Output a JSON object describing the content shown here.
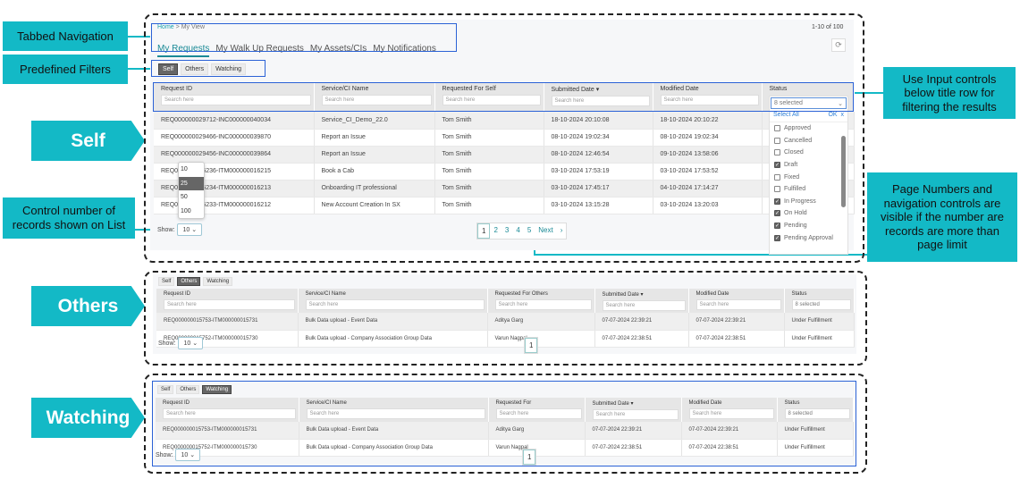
{
  "annotations": {
    "tabbed_navigation": "Tabbed Navigation",
    "predefined_filters": "Predefined Filters",
    "self": "Self",
    "others": "Others",
    "watching": "Watching",
    "control_records": "Control number of records shown on List",
    "input_controls": "Use Input controls below title row for filtering the results",
    "page_numbers": "Page Numbers and navigation controls are visible if the number are records are more than page limit"
  },
  "colors": {
    "accent": "#13b9c6",
    "annotation_border": "#2b62d6",
    "active_tab": "#1a8a96"
  },
  "header": {
    "breadcrumb_home": "Home",
    "breadcrumb_sep": ">",
    "breadcrumb_current": "My View",
    "record_count": "1-10 of 100",
    "refresh_icon": "refresh-icon",
    "tabs": [
      "My Requests",
      "My Walk Up Requests",
      "My Assets/CIs",
      "My Notifications"
    ]
  },
  "filters": [
    "Self",
    "Others",
    "Watching"
  ],
  "search_placeholder": "Search here",
  "status_filter": {
    "value": "8 selected",
    "select_all": "Select All",
    "ok": "OK",
    "close": "x",
    "options": [
      {
        "label": "Approved",
        "checked": false
      },
      {
        "label": "Cancelled",
        "checked": false
      },
      {
        "label": "Closed",
        "checked": false
      },
      {
        "label": "Draft",
        "checked": true
      },
      {
        "label": "Fixed",
        "checked": false
      },
      {
        "label": "Fulfilled",
        "checked": false
      },
      {
        "label": "In Progress",
        "checked": true
      },
      {
        "label": "On Hold",
        "checked": true
      },
      {
        "label": "Pending",
        "checked": true
      },
      {
        "label": "Pending Approval",
        "checked": true
      }
    ]
  },
  "show": {
    "label": "Show:",
    "value": "10",
    "options": [
      "10",
      "25",
      "50",
      "100"
    ],
    "highlighted": "25"
  },
  "pagination": {
    "pages": [
      "1",
      "2",
      "3",
      "4",
      "5"
    ],
    "current": "1",
    "next": "Next",
    "next_icon": "›"
  },
  "tables": {
    "self": {
      "columns": [
        "Request ID",
        "Service/CI Name",
        "Requested For Self",
        "Submitted Date ▾",
        "Modified Date",
        "Status"
      ],
      "rows": [
        [
          "REQ000000029712-INC000000040034",
          "Service_CI_Demo_22.0",
          "Tom Smith",
          "18-10-2024 20:10:08",
          "18-10-2024 20:10:22",
          ""
        ],
        [
          "REQ000000029466-INC000000039870",
          "Report an Issue",
          "Tom Smith",
          "08-10-2024 19:02:34",
          "08-10-2024 19:02:34",
          ""
        ],
        [
          "REQ000000029456-INC000000039864",
          "Report an Issue",
          "Tom Smith",
          "08-10-2024 12:46:54",
          "09-10-2024 13:58:06",
          ""
        ],
        [
          "REQ000000016236-ITM000000016215",
          "Book a Cab",
          "Tom Smith",
          "03-10-2024 17:53:19",
          "03-10-2024 17:53:52",
          ""
        ],
        [
          "REQ000000016234-ITM000000016213",
          "Onboarding IT professional",
          "Tom Smith",
          "03-10-2024 17:45:17",
          "04-10-2024 17:14:27",
          ""
        ],
        [
          "REQ000000016233-ITM000000016212",
          "New Account Creation In SX",
          "Tom Smith",
          "03-10-2024 13:15:28",
          "03-10-2024 13:20:03",
          ""
        ]
      ]
    },
    "others": {
      "columns": [
        "Request ID",
        "Service/CI Name",
        "Requested For Others",
        "Submitted Date ▾",
        "Modified Date",
        "Status"
      ],
      "rows": [
        [
          "REQ000000015753-ITM000000015731",
          "Bulk Data upload - Event Data",
          "Aditya Garg",
          "07-07-2024 22:39:21",
          "07-07-2024 22:39:21",
          "Under Fulfillment"
        ],
        [
          "REQ000000015752-ITM000000015730",
          "Bulk Data upload - Company Association Group Data",
          "Varun Nagpal",
          "07-07-2024 22:38:51",
          "07-07-2024 22:38:51",
          "Under Fulfillment"
        ]
      ]
    },
    "watching": {
      "columns": [
        "Request ID",
        "Service/CI Name",
        "Requested For",
        "Submitted Date ▾",
        "Modified Date",
        "Status"
      ],
      "rows": [
        [
          "REQ000000015753-ITM000000015731",
          "Bulk Data upload - Event Data",
          "Aditya Garg",
          "07-07-2024 22:39:21",
          "07-07-2024 22:39:21",
          "Under Fulfillment"
        ],
        [
          "REQ000000015752-ITM000000015730",
          "Bulk Data upload - Company Association Group Data",
          "Varun Nagpal",
          "07-07-2024 22:38:51",
          "07-07-2024 22:38:51",
          "Under Fulfillment"
        ]
      ]
    }
  }
}
